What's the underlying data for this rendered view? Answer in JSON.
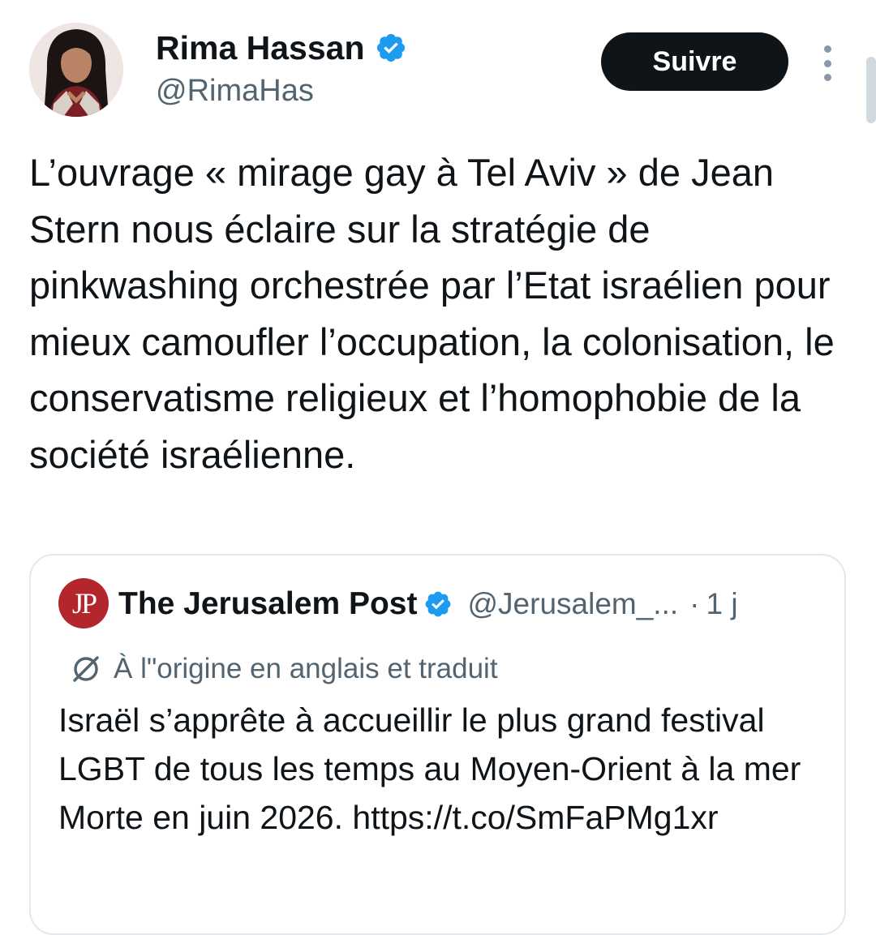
{
  "author": {
    "name": "Rima Hassan",
    "handle": "@RimaHas",
    "verified": true
  },
  "actions": {
    "follow_label": "Suivre",
    "more_icon": "more-vertical-icon"
  },
  "tweet": {
    "text": "L’ouvrage « mirage gay à Tel Aviv » de Jean Stern nous éclaire sur la stratégie de pinkwashing orchestrée par l’Etat israélien pour mieux camoufler l’occupation, la colonisation, le conservatisme religieux et l’homophobie de la société israélienne."
  },
  "quoted": {
    "logo_text": "JP",
    "name": "The Jerusalem Post",
    "verified": true,
    "handle": "@Jerusalem_...",
    "separator": "·",
    "time": "1 j",
    "translated_label": "À l\"origine en anglais et traduit",
    "text": "Israël s’apprête à accueillir le plus grand festival LGBT de tous les temps au Moyen-Orient à la mer Morte en juin 2026. https://t.co/SmFaPMg1xr"
  },
  "colors": {
    "primary_text": "#0f1419",
    "secondary_text": "#536471",
    "verified_blue": "#1d9bf0",
    "follow_button_bg": "#0f1419",
    "card_border": "#e3e8ec",
    "jp_logo_red": "#b3262c"
  }
}
